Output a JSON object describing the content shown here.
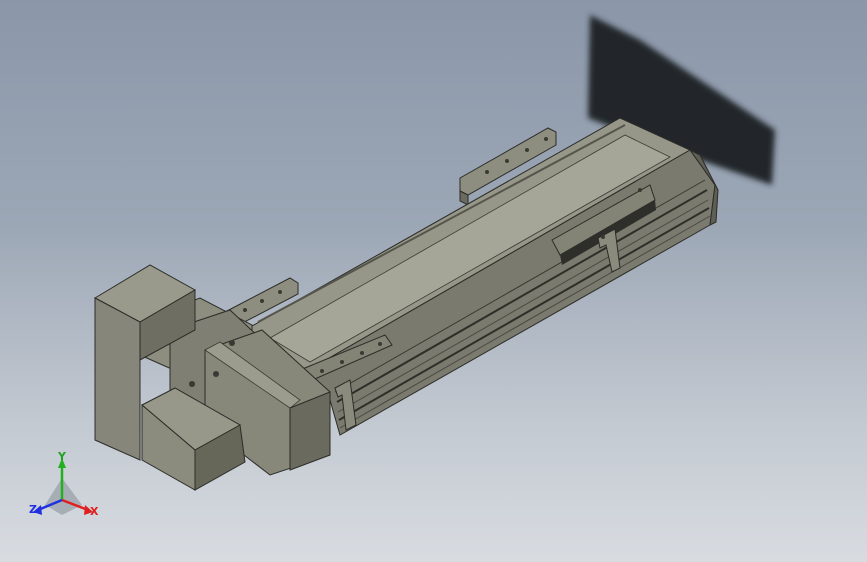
{
  "view": {
    "triad": {
      "x_label": "X",
      "y_label": "Y",
      "z_label": "Z",
      "x_color": "#e02020",
      "y_color": "#20b020",
      "z_color": "#2030e0"
    },
    "colors": {
      "body": "#8f8f82",
      "body_dark": "#5c5c53",
      "body_light": "#a9a99b",
      "shadow": "#262a2f"
    }
  }
}
